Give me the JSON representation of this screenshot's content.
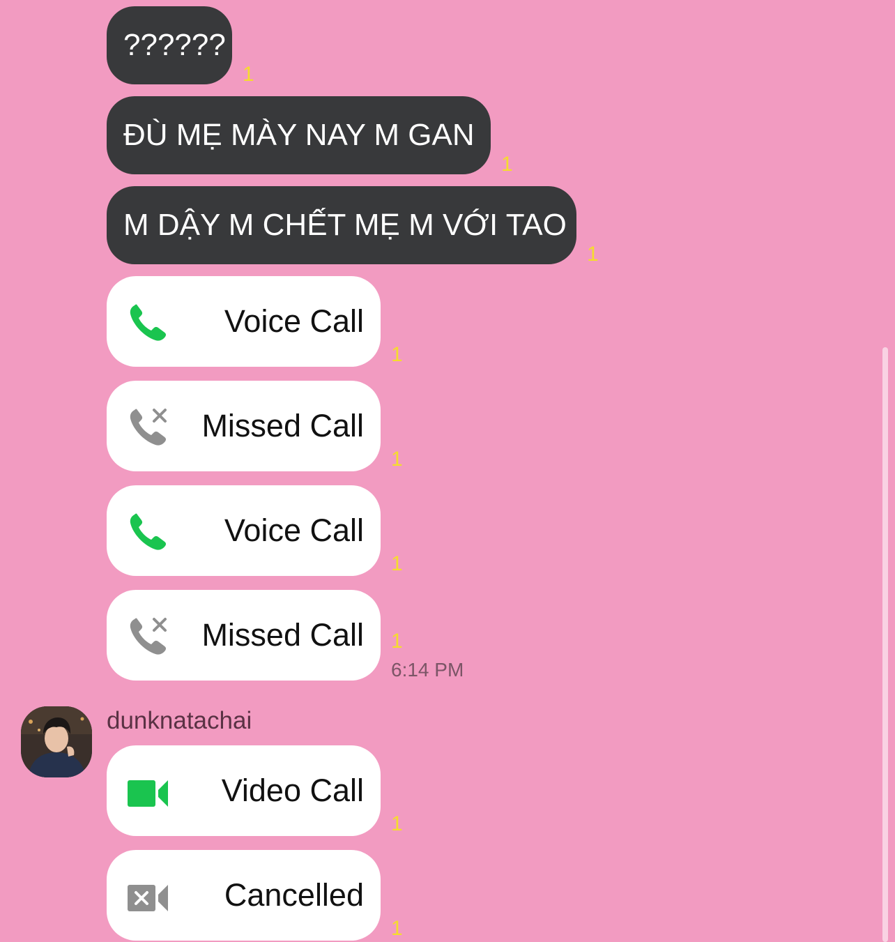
{
  "messages": {
    "text": [
      {
        "text": "??????",
        "read": "1"
      },
      {
        "text": "ĐÙ MẸ MÀY NAY M GAN",
        "read": "1"
      },
      {
        "text": "M DẬY M CHẾT MẸ M VỚI TAO",
        "read": "1"
      }
    ],
    "calls": [
      {
        "label": "Voice Call",
        "icon": "phone-icon",
        "read": "1"
      },
      {
        "label": "Missed Call",
        "icon": "missed-call-icon",
        "read": "1"
      },
      {
        "label": "Voice Call",
        "icon": "phone-icon",
        "read": "1"
      },
      {
        "label": "Missed Call",
        "icon": "missed-call-icon",
        "read": "1",
        "time": "6:14 PM"
      }
    ]
  },
  "sender": {
    "name": "dunknatachai",
    "avatar": "avatar-photo"
  },
  "sender_calls": [
    {
      "label": "Video Call",
      "icon": "video-camera-icon",
      "read": "1"
    },
    {
      "label": "Cancelled",
      "icon": "video-cancelled-icon",
      "read": "1"
    }
  ],
  "colors": {
    "background": "#f29bc1",
    "dark_bubble": "#38393b",
    "call_bubble": "#ffffff",
    "accept_green": "#1ac44f",
    "missed_gray": "#8f8f8f",
    "read_yellow": "#f5dc2d"
  }
}
